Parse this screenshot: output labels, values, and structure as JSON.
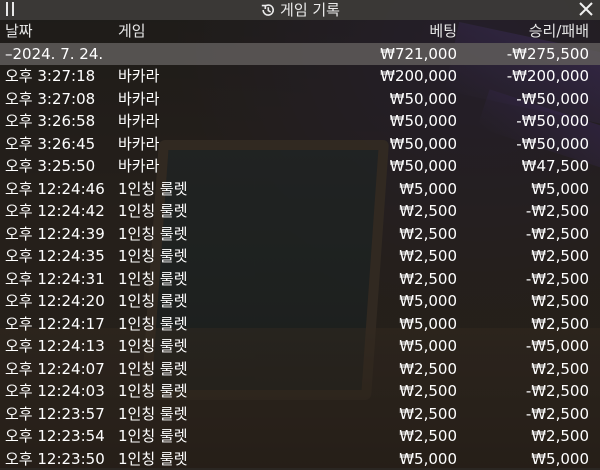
{
  "title": "게임 기록",
  "columns": {
    "date": "날짜",
    "game": "게임",
    "bet": "베팅",
    "result": "승리/패배"
  },
  "summary": {
    "date": "–2024. 7. 24.",
    "bet": "₩721,000",
    "result": "-₩275,500"
  },
  "rows": [
    {
      "time": "오후 3:27:18",
      "game": "바카라",
      "bet": "₩200,000",
      "result": "-₩200,000"
    },
    {
      "time": "오후 3:27:08",
      "game": "바카라",
      "bet": "₩50,000",
      "result": "-₩50,000"
    },
    {
      "time": "오후 3:26:58",
      "game": "바카라",
      "bet": "₩50,000",
      "result": "-₩50,000"
    },
    {
      "time": "오후 3:26:45",
      "game": "바카라",
      "bet": "₩50,000",
      "result": "-₩50,000"
    },
    {
      "time": "오후 3:25:50",
      "game": "바카라",
      "bet": "₩50,000",
      "result": "₩47,500"
    },
    {
      "time": "오후 12:24:46",
      "game": "1인칭 룰렛",
      "bet": "₩5,000",
      "result": "₩5,000"
    },
    {
      "time": "오후 12:24:42",
      "game": "1인칭 룰렛",
      "bet": "₩2,500",
      "result": "-₩2,500"
    },
    {
      "time": "오후 12:24:39",
      "game": "1인칭 룰렛",
      "bet": "₩2,500",
      "result": "-₩2,500"
    },
    {
      "time": "오후 12:24:35",
      "game": "1인칭 룰렛",
      "bet": "₩2,500",
      "result": "₩2,500"
    },
    {
      "time": "오후 12:24:31",
      "game": "1인칭 룰렛",
      "bet": "₩2,500",
      "result": "-₩2,500"
    },
    {
      "time": "오후 12:24:20",
      "game": "1인칭 룰렛",
      "bet": "₩5,000",
      "result": "₩2,500"
    },
    {
      "time": "오후 12:24:17",
      "game": "1인칭 룰렛",
      "bet": "₩5,000",
      "result": "₩2,500"
    },
    {
      "time": "오후 12:24:13",
      "game": "1인칭 룰렛",
      "bet": "₩5,000",
      "result": "-₩5,000"
    },
    {
      "time": "오후 12:24:07",
      "game": "1인칭 룰렛",
      "bet": "₩2,500",
      "result": "₩2,500"
    },
    {
      "time": "오후 12:24:03",
      "game": "1인칭 룰렛",
      "bet": "₩2,500",
      "result": "-₩2,500"
    },
    {
      "time": "오후 12:23:57",
      "game": "1인칭 룰렛",
      "bet": "₩2,500",
      "result": "-₩2,500"
    },
    {
      "time": "오후 12:23:54",
      "game": "1인칭 룰렛",
      "bet": "₩2,500",
      "result": "₩2,500"
    },
    {
      "time": "오후 12:23:50",
      "game": "1인칭 룰렛",
      "bet": "₩5,000",
      "result": "₩5,000"
    }
  ],
  "icons": {
    "title_icon": "history-icon",
    "left_icon": "menu-handle-icon",
    "right_icon": "close-icon"
  },
  "colors": {
    "text": "#ffffff",
    "summary_row": "#5f5c5a",
    "title_bar": "#3c3a38"
  }
}
